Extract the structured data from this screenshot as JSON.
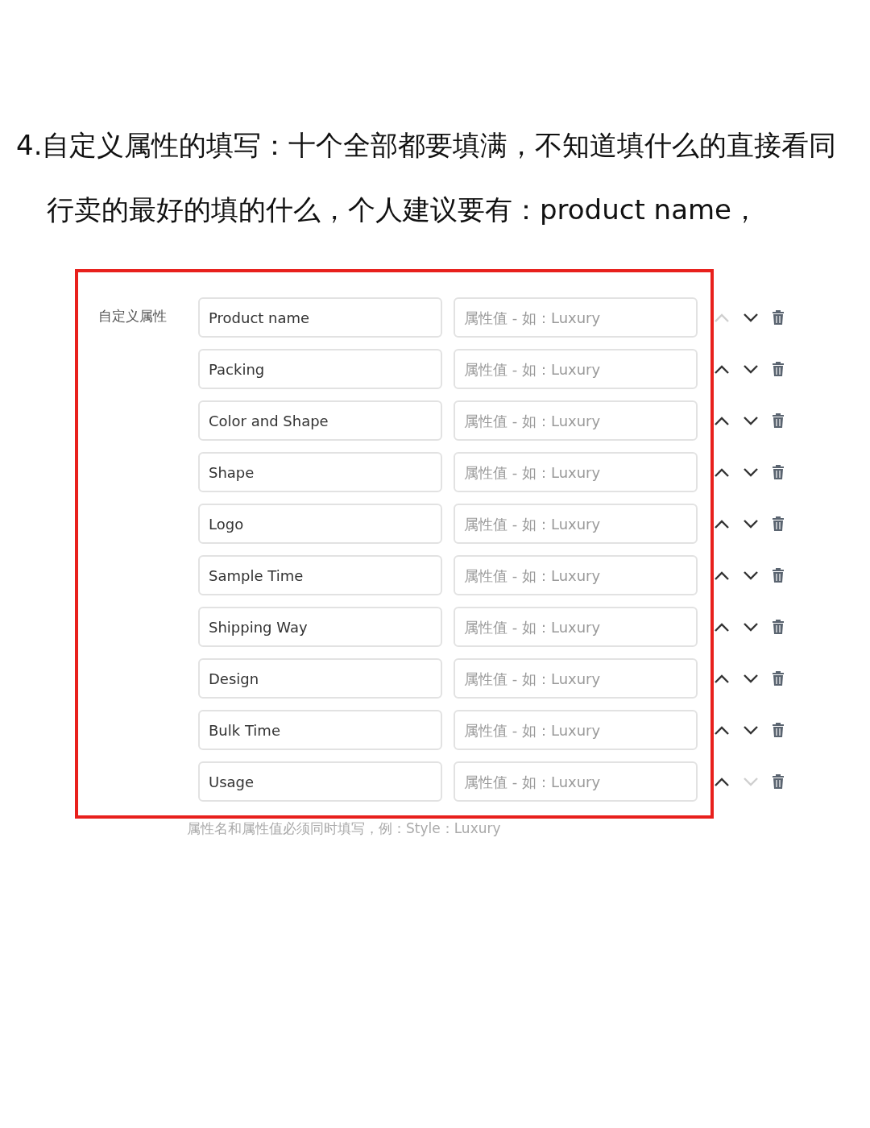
{
  "heading": {
    "lines": [
      "4.自定义属性的填写：十个全部都要填满，不知道填什么的直接看同",
      "行卖的最好的填的什么，个人建议要有：product name，"
    ]
  },
  "form": {
    "label": "自定义属性",
    "rows": [
      {
        "name": "Product name",
        "placeholder": "属性值 - 如：Luxury",
        "up_disabled": true,
        "down_disabled": false
      },
      {
        "name": "Packing",
        "placeholder": "属性值 - 如：Luxury",
        "up_disabled": false,
        "down_disabled": false
      },
      {
        "name": "Color and Shape",
        "placeholder": "属性值 - 如：Luxury",
        "up_disabled": false,
        "down_disabled": false
      },
      {
        "name": "Shape",
        "placeholder": "属性值 - 如：Luxury",
        "up_disabled": false,
        "down_disabled": false
      },
      {
        "name": "Logo",
        "placeholder": "属性值 - 如：Luxury",
        "up_disabled": false,
        "down_disabled": false
      },
      {
        "name": "Sample Time",
        "placeholder": "属性值 - 如：Luxury",
        "up_disabled": false,
        "down_disabled": false
      },
      {
        "name": "Shipping Way",
        "placeholder": "属性值 - 如：Luxury",
        "up_disabled": false,
        "down_disabled": false
      },
      {
        "name": "Design",
        "placeholder": "属性值 - 如：Luxury",
        "up_disabled": false,
        "down_disabled": false
      },
      {
        "name": "Bulk Time",
        "placeholder": "属性值 - 如：Luxury",
        "up_disabled": false,
        "down_disabled": false
      },
      {
        "name": "Usage",
        "placeholder": "属性值 - 如：Luxury",
        "up_disabled": false,
        "down_disabled": true
      }
    ],
    "hint": "属性名和属性值必须同时填写，例：Style：Luxury"
  }
}
